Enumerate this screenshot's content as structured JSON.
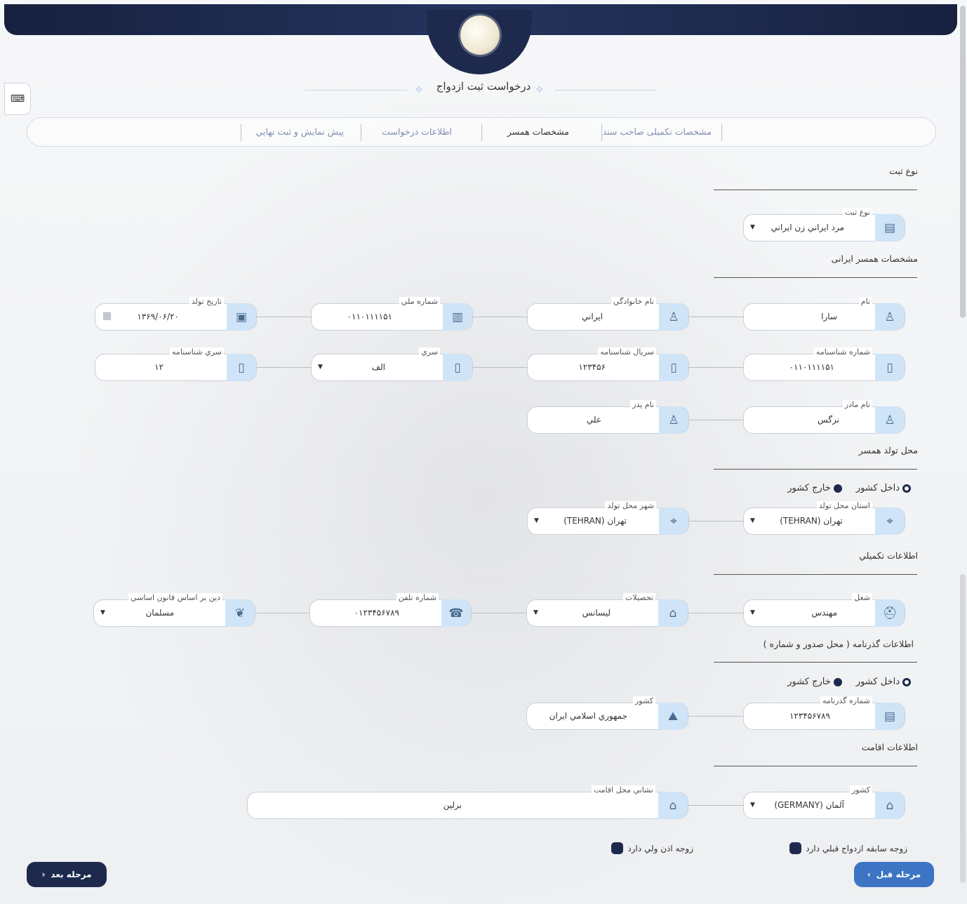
{
  "header": {
    "title": "درخواست ثبت ازدواج"
  },
  "toolbar": {
    "keyboard_icon": "keyboard-icon"
  },
  "steps": [
    {
      "label": "مشخصات تكميلی صاحب سند",
      "active": false
    },
    {
      "label": "مشخصات همسر",
      "active": true
    },
    {
      "label": "اطلاعات درخواست",
      "active": false
    },
    {
      "label": "پيش نمايش و ثبت نهايي",
      "active": false
    }
  ],
  "sections": {
    "reg_type": "نوع ثبت",
    "spouse_info": "مشخصات همسر ايرانی",
    "birth_place": "محل تولد همسر",
    "extra_info": "اطلاعات تكميلي",
    "passport_info": "اطلاعات گذرنامه ( محل صدور و شماره )",
    "residence_info": "اطلاعات اقامت"
  },
  "fields": {
    "reg_type": {
      "label": "نوع ثبت",
      "value": "مرد ايراني زن ايراني"
    },
    "first_name": {
      "label": "نام",
      "value": "سارا"
    },
    "last_name": {
      "label": "نام خانوادگي",
      "value": "ايراني"
    },
    "national_id": {
      "label": "شماره ملي",
      "value": "۰۱۱۰۱۱۱۱۵۱"
    },
    "birth_date": {
      "label": "تاريخ تولد",
      "value": "۱۳۶۹/۰۶/۲۰"
    },
    "cert_no": {
      "label": "شماره شناسنامه",
      "value": "۰۱۱۰۱۱۱۱۵۱"
    },
    "cert_serial": {
      "label": "سريال شناسنامه",
      "value": "۱۲۳۴۵۶"
    },
    "series": {
      "label": "سري",
      "value": "الف"
    },
    "cert_series": {
      "label": "سري شناسنامه",
      "value": "۱۲"
    },
    "mother_name": {
      "label": "نام مادر",
      "value": "نرگس"
    },
    "father_name": {
      "label": "نام پدر",
      "value": "علي"
    },
    "birth_province": {
      "label": "استان محل تولد",
      "value": "تهران (TEHRAN)"
    },
    "birth_city": {
      "label": "شهر محل تولد",
      "value": "تهران (TEHRAN)"
    },
    "job": {
      "label": "شغل",
      "value": "مهندس"
    },
    "education": {
      "label": "تحصيلات",
      "value": "ليسانس"
    },
    "phone": {
      "label": "شماره تلفن",
      "value": "۰۱۲۳۴۵۶۷۸۹"
    },
    "religion": {
      "label": "دين بر اساس قانون اساسي",
      "value": "مسلمان"
    },
    "passport_no": {
      "label": "شماره گذرنامه",
      "value": "۱۲۳۴۵۶۷۸۹"
    },
    "passport_country": {
      "label": "كشور",
      "value": "جمهوري اسلامي ايران"
    },
    "res_country": {
      "label": "كشور",
      "value": "آلمان (GERMANY)"
    },
    "res_address": {
      "label": "نشاني محل اقامت",
      "value": "برلين"
    }
  },
  "radios": {
    "inside": "داخل كشور",
    "outside": "خارج كشور"
  },
  "checkboxes": {
    "prev_marriage": "زوجه سابقه ازدواج قبلي دارد",
    "guardian_permit": "زوجه اذن ولي دارد"
  },
  "buttons": {
    "prev": "مرحله قبل",
    "next": "مرحله بعد"
  },
  "colors": {
    "header_navy": "#1d2a4d",
    "icon_bg": "#cfe4f7",
    "primary_button": "#3d74c4"
  }
}
